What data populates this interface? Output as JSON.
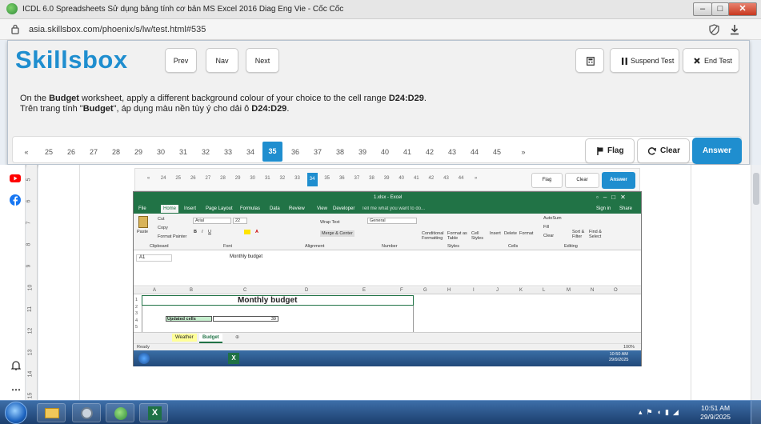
{
  "browser": {
    "title": "ICDL 6.0 Spreadsheets Sử dụng bảng tính cơ bản MS Excel 2016 Diag Eng Vie - Cốc Cốc",
    "url": "asia.skillsbox.com/phoenix/s/lw/test.html#535"
  },
  "app": {
    "logo": "Skillsbox",
    "prev_label": "Prev",
    "nav_label": "Nav",
    "next_label": "Next",
    "suspend_label": "Suspend Test",
    "end_label": "End Test",
    "question_en_1": "On the ",
    "question_en_b1": "Budget",
    "question_en_2": " worksheet, apply a different background colour of your choice to the cell range ",
    "question_en_b2": "D24:D29",
    "question_en_3": ".",
    "question_vi_1": "Trên trang tính \"",
    "question_vi_b1": "Budget",
    "question_vi_2": "\", áp dụng màu nền tùy ý cho dải ô ",
    "question_vi_b2": "D24:D29",
    "question_vi_3": ".",
    "pager": {
      "first": "«",
      "last": "»",
      "pages": [
        "25",
        "26",
        "27",
        "28",
        "29",
        "30",
        "31",
        "32",
        "33",
        "34",
        "35",
        "36",
        "37",
        "38",
        "39",
        "40",
        "41",
        "42",
        "43",
        "44",
        "45"
      ],
      "current": "35"
    },
    "flag_label": "Flag",
    "clear_label": "Clear",
    "answer_label": "Answer"
  },
  "mini": {
    "pages": [
      "«",
      "24",
      "25",
      "26",
      "27",
      "28",
      "29",
      "30",
      "31",
      "32",
      "33",
      "34",
      "35",
      "36",
      "37",
      "38",
      "39",
      "40",
      "41",
      "42",
      "43",
      "44",
      "»"
    ],
    "current": "34",
    "flag_label": "Flag",
    "clear_label": "Clear",
    "answer_label": "Answer"
  },
  "ruler": [
    "5",
    "6",
    "7",
    "8",
    "9",
    "10",
    "11",
    "12",
    "13",
    "14",
    "15"
  ],
  "excel": {
    "title": "1.xlsx - Excel",
    "tabs": [
      "File",
      "Home",
      "Insert",
      "Page Layout",
      "Formulas",
      "Data",
      "Review",
      "View",
      "Developer"
    ],
    "tell_me": "Tell me what you want to do...",
    "sign_in": "Sign in",
    "share": "Share",
    "font_name": "Arial",
    "font_size": "22",
    "number_format": "General",
    "clipboard": [
      "Cut",
      "Copy",
      "Format Painter",
      "Paste",
      "Clipboard"
    ],
    "groups": [
      "Font",
      "Alignment",
      "Number",
      "Styles",
      "Cells",
      "Editing"
    ],
    "wrap_text": "Wrap Text",
    "merge_center": "Merge & Center",
    "styles": [
      "Conditional Formatting",
      "Format as Table",
      "Cell Styles"
    ],
    "cells": [
      "Insert",
      "Delete",
      "Format"
    ],
    "editing": [
      "AutoSum",
      "Fill",
      "Clear",
      "Sort & Filter",
      "Find & Select"
    ],
    "name_box": "A1",
    "formula": "Monthly budget",
    "columns": [
      "A",
      "B",
      "C",
      "D",
      "E",
      "F",
      "G",
      "H",
      "I",
      "J",
      "K",
      "L",
      "M",
      "N",
      "O"
    ],
    "rows": [
      "1",
      "2",
      "3",
      "4",
      "5"
    ],
    "cell_title": "Monthly budget",
    "cell_b4": "Updated cells",
    "cell_c4": "39",
    "sheets": [
      "Weather",
      "Budget"
    ],
    "status": "Ready",
    "zoom": "100%",
    "time": "10:50 AM",
    "date": "29/9/2025"
  },
  "taskbar": {
    "time": "10:51 AM",
    "date": "29/9/2025"
  },
  "colors": {
    "brand": "#1f8ecf",
    "brand_dark": "#1a1f3a",
    "excel_green": "#217346",
    "taskbar": "#1c3f6e"
  }
}
